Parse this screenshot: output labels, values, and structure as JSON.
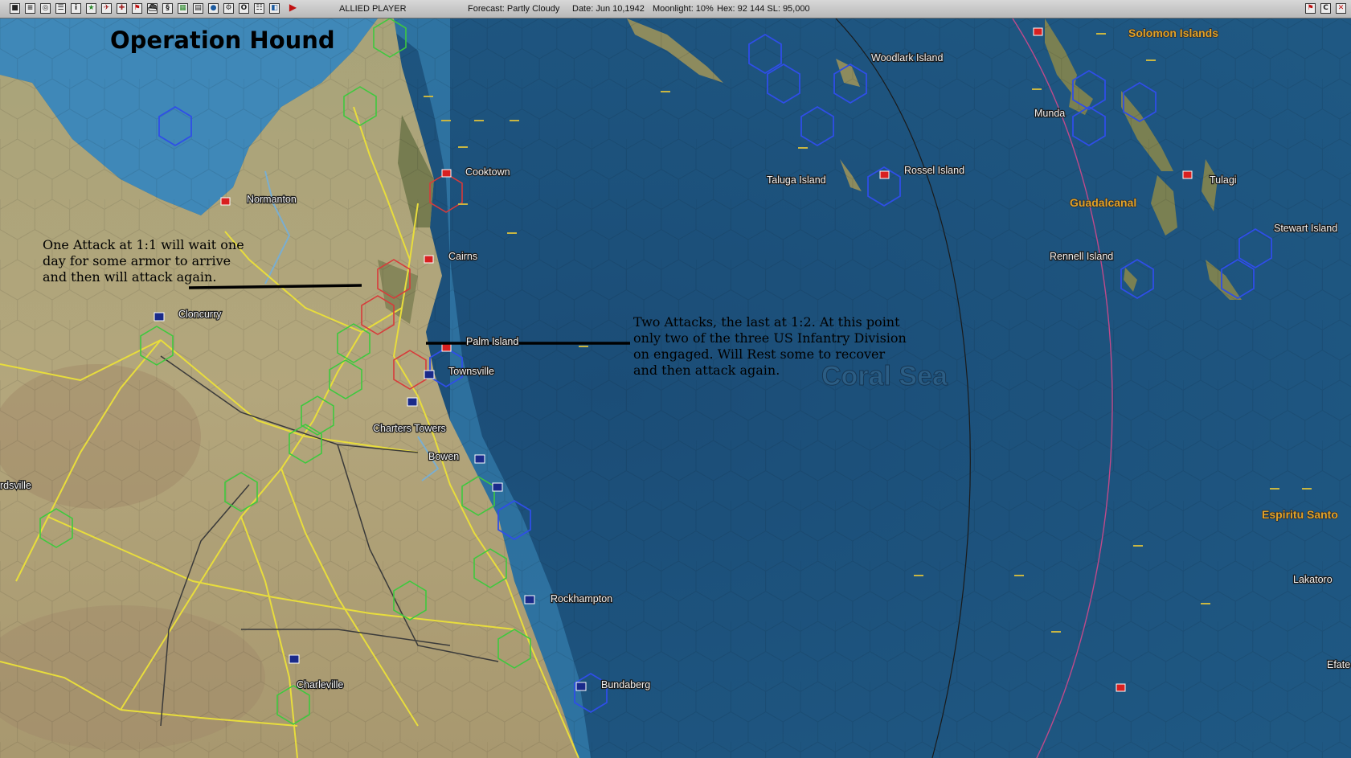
{
  "toolbar": {
    "buttons": [
      "sys-menu",
      "reports",
      "intel",
      "events",
      "ships",
      "info",
      "aircraft",
      "ground",
      "flag",
      "overview",
      "tactics",
      "editor",
      "map",
      "orders",
      "base",
      "resources",
      "ledger",
      "save",
      "end-turn"
    ],
    "player": "ALLIED PLAYER",
    "forecast": "Forecast: Partly Cloudy",
    "date": "Date: Jun 10,1942",
    "moonlight": "Moonlight: 10%",
    "hex": "Hex: 92 144  SL: 95,000",
    "right_buttons": [
      "flag-right",
      "cust-c",
      "close-x"
    ]
  },
  "map": {
    "title": "Operation Hound",
    "annotation_1": [
      "One Attack at 1:1 will wait one",
      "day for some armor to arrive",
      "and then will attack again."
    ],
    "annotation_2": [
      "Two Attacks, the last at 1:2. At this point",
      "only two of the three US Infantry Division",
      "on engaged. Will Rest some to recover",
      "and then attack again."
    ],
    "sea_name": "Coral Sea",
    "places": [
      "Normanton",
      "Cooktown",
      "Cairns",
      "Cloncurry",
      "Palm Island",
      "Townsville",
      "Charters Towers",
      "Bowen",
      "Rockhampton",
      "Charleville",
      "Bundaberg",
      "rdsville",
      "Woodlark Island",
      "Taluga Island",
      "Rossel Island",
      "Rennell Island",
      "Munda",
      "Tulagi",
      "Stewart Island",
      "Lakatoro",
      "Efate"
    ],
    "region_names": [
      "Solomon Islands",
      "Guadalcanal",
      "Espiritu Santo"
    ]
  },
  "colors": {
    "sea": "#1e5883",
    "land": "#b0a47a",
    "road": "#e6dc3a",
    "friendly_hex": "#3ac33a",
    "enemy_hex": "#d83a3a",
    "naval_hex": "#2a45e0"
  }
}
